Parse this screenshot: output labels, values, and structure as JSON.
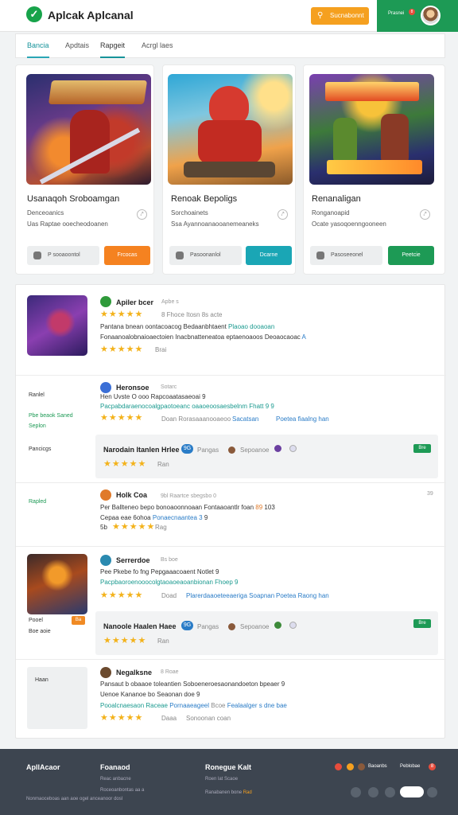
{
  "header": {
    "app_title": "Aplcak Aplcanal",
    "search_label": "Sucnabonnt",
    "account_label": "Prasnei",
    "account_badge": "8"
  },
  "tabs": [
    "Bancia",
    "Apdtais",
    "Rapgeit",
    "Acrgl laes"
  ],
  "cards": [
    {
      "title": "Usanaqoh Sroboamgan",
      "sub1": "Denceoanics",
      "sub2": "Uas Raptae ooecheodoanen",
      "secondary": "P sooaoontol",
      "primary": "Frcocas",
      "primary_color": "#f58220"
    },
    {
      "title": "Renoak Bepoligs",
      "sub1": "Sorchoainets",
      "sub2": "Ssa Ayannoanaooanemeaneks",
      "secondary": "Pasoonanlol",
      "primary": "Dcarne",
      "primary_color": "#1aa6b5"
    },
    {
      "title": "Renanaligan",
      "sub1": "Ronganoapid",
      "sub2": "Ocate yasoqoenngooneen",
      "secondary": "Pasoseeonel",
      "primary": "Peetcie",
      "primary_color": "#1d9a55"
    }
  ],
  "feed": {
    "r1": {
      "name": "Apiler bcer",
      "meta": "Apbe s",
      "rating_text": "8 Fhoce Itosn 8s acte",
      "body1": "Pantana bnean oontacoacog Bedaanbhtaent",
      "body1_link": "Plaoao dooaoan",
      "body2": "Fonaanoalobnaioaectoien Inacbnatteneatoa eptaenoaoos Deoaocaoac",
      "body2_link": "A",
      "foot": "Brai"
    },
    "r2": {
      "name": "Heronsoe",
      "meta": "Sotarc",
      "line1": "Hen Uvste O ooo Rapcoaatasaeoai 9",
      "line2": "Pacpabdaraenocoalgpaotoeanc oaaoeoosaesbelnm Fhatt 9 9",
      "stars_label": "Doan Rorasaaanooaeoo",
      "stars_link": "Sacatsan",
      "stars_link2": "Poetea fiaalng han",
      "side_label": "Ranlel",
      "side_green1": "Pbe beaok Saned",
      "side_green2": "Seplon",
      "side_label2": "Pancicgs",
      "reply": {
        "name": "Narodain Itanlen Hrlee",
        "badge": "9G",
        "text1": "Pangas",
        "text2": "Sepoanoe",
        "pill": "Bre",
        "foot": "Ran"
      }
    },
    "r3": {
      "name": "Holk Coa",
      "meta": "9bl Raartce sbegsbo 0",
      "line1": "Per Ballteneo bepo bonoaoonnoaan Fontaaoantlr foan",
      "line1_num": "89",
      "line1_tail": "103",
      "line2_a": "Cepaa eae 6ohoa",
      "line2_link": "Ponaecnaantea 3",
      "line2_tail": "9",
      "stars_prefix": "5b",
      "stars_foot": "Rag",
      "side_green": "Rapled",
      "side_num": "39"
    },
    "r4": {
      "name": "Serrerdoe",
      "meta": "Bs boe",
      "line1": "Pee Pkebe fo fng Pepgaaacoaent Notlet 9",
      "line2": "Pacpbaoroenooocolgtaoaoeaoanbionan Fhoep 9",
      "stars_label": "Doad",
      "stars_link": "Plarerdaaoeteeaeriga Soapnan",
      "stars_link2": "Poetea Raong han",
      "side_label": "Pooel",
      "side_pill": "Ba",
      "side_label2": "Boe aoie",
      "reply": {
        "name": "Nanoole Haalen Haee",
        "badge": "9G",
        "text1": "Pangas",
        "text2": "Sepoanoe",
        "pill": "Bre",
        "foot": "Ran"
      }
    },
    "r5": {
      "name": "Negalksne",
      "meta": "8 Roae",
      "side_label": "Haan",
      "line1": "Pansaut b obaaoe toleantien Soboeneroesaonandoeton bpeaer 9",
      "line2": "Uenoe Kananoe bo Seaonan doe 9",
      "line3_a": "Pooalcnaesaon Raceae",
      "line3_b": "Pornaaeageel",
      "line3_c": "Bcoe",
      "line3_d": "Fealaalger s dne bae",
      "stars_label": "Daaa",
      "stars_link": "Sonoonan coan"
    }
  },
  "footer": {
    "brand": "ApllAcaor",
    "col1_title": "Foanaod",
    "col1_a": "Reac anbacne",
    "col1_b": "Roceoanbontas aa a",
    "col1_c": "Nonmaoceboas aan aoe ogel anceanoor dosl",
    "col2_title": "Ronegue Kalt",
    "col2_a": "Roen lat Scaoe",
    "col2_b": "Ranabanen bone",
    "col2_b_hi": "Rad",
    "r_a": "Baoanbs",
    "r_b": "Peblobae",
    "badge": "8"
  }
}
